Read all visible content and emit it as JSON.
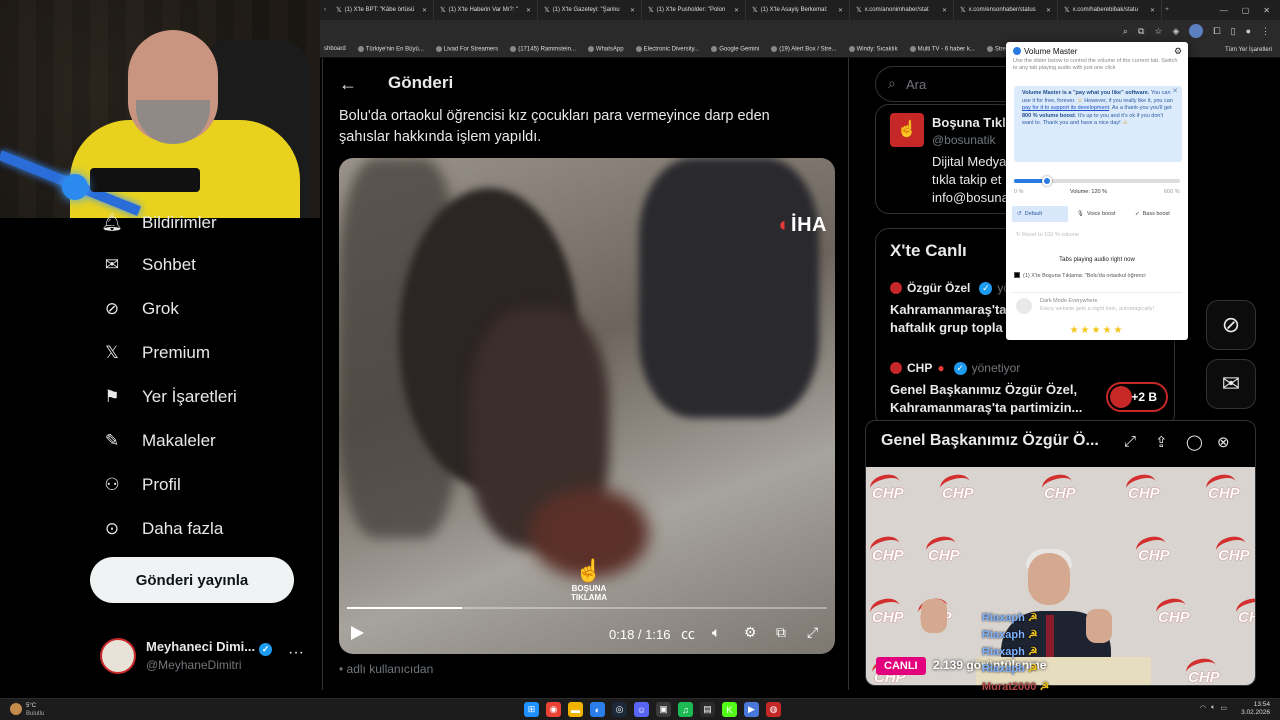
{
  "browser": {
    "tabs": [
      {
        "label": "(1) X'te BPT: \"Kâbe örtüsü"
      },
      {
        "label": "(1) X'te Haberin Var Mı?: \""
      },
      {
        "label": "(1) X'te Gazeteyi: \"Şanlıu"
      },
      {
        "label": "(1) X'te Pusholder: \"Polon"
      },
      {
        "label": "(1) X'te Asayiş Berkemal:"
      },
      {
        "label": "x.com/anonimhaber/stat"
      },
      {
        "label": "x.com/ensonhaber/status"
      },
      {
        "label": "x.com/haberebibak/statu"
      }
    ],
    "bookmarks": [
      "shboard",
      "Türkiye'nin En Büyü...",
      "Livad For Streamers",
      "(17145) Rammstein...",
      "WhatsApp",
      "Electronic Diversity...",
      "Google Gemini",
      "(19) Alert Box / Stre...",
      "Windy: Sıcaklık",
      "Multi TV - 6 haber k...",
      "Stream"
    ],
    "bookmarks_all": "Tüm Yer İşaretleri"
  },
  "sidebar": {
    "items": [
      {
        "label": "Bildirimler",
        "icon": "bell-icon"
      },
      {
        "label": "Sohbet",
        "icon": "mail-icon"
      },
      {
        "label": "Grok",
        "icon": "grok-icon"
      },
      {
        "label": "Premium",
        "icon": "x-logo-icon"
      },
      {
        "label": "Yer İşaretleri",
        "icon": "bookmark-icon"
      },
      {
        "label": "Makaleler",
        "icon": "article-icon"
      },
      {
        "label": "Profil",
        "icon": "person-icon"
      },
      {
        "label": "Daha fazla",
        "icon": "more-circle-icon"
      }
    ],
    "post_button": "Gönderi yayınla",
    "account": {
      "name": "Meyhaneci Dimi...",
      "handle": "@MeyhaneDimitri",
      "more": "···"
    }
  },
  "main": {
    "title": "Gönderi",
    "post_text": "Bolu'da ortaokul öğrencisi kız çocukları para vermeyince darp eden şahıslar hakkında işlem yapıldı.",
    "video": {
      "watermark": "İHA",
      "overlay_logo": "BOŞUNA TIKLAMA",
      "time": "0:18 / 1:16",
      "progress": 0.24
    },
    "below_text": "adlı kullanıcıdan"
  },
  "right": {
    "search_placeholder": "Ara",
    "promo": {
      "name": "Boşuna Tıkl",
      "handle": "@bosunatik",
      "desc_lines": [
        "Dijital Medya",
        "tıkla takip et",
        "info@bosuna"
      ]
    },
    "live": {
      "title": "X'te Canlı",
      "items": [
        {
          "name": "Özgür Özel",
          "role": "yön",
          "text_lines": [
            "Kahramanmaraş'ta",
            "haftalık grup topla"
          ]
        },
        {
          "name": "CHP",
          "role": "yönetiyor",
          "text_lines": [
            "Genel Başkanımız Özgür Özel,",
            "Kahramanmaraş'ta partimizin..."
          ]
        }
      ],
      "badge": "+2 B"
    }
  },
  "volume_master": {
    "title": "Volume Master",
    "hint": "Use the slider below to control the volume of the current tab. Switch to any tab playing audio with just one click",
    "note": {
      "bold": "Volume Master is a \"pay what you like\" software.",
      "p1": " You can use it for free, forever. ",
      "p2": "However, if you really like it, you can ",
      "link": "pay for it to support its development",
      "p3": ". As a thank-you you'll get ",
      "bold2": "800 % volume boost",
      "p4": ". It's up to you and it's ok if you don't want to. Thank you and have a nice day! "
    },
    "scale_min": "0 %",
    "volume_label": "Volume: 120 %",
    "scale_max": "600 %",
    "volume_fraction": 0.2,
    "presets": [
      "Default",
      "Voice boost",
      "Bass boost"
    ],
    "reset": "Reset to 100 % volume",
    "tabs_title": "Tabs playing audio right now",
    "playing_tab": "(1) X'te Boşuna Tıklama: \"Bolu'da ortaokul öğrenci",
    "ad_title": "Dark Mode Everywhere",
    "ad_desc": "Every website gets a night look, automagically!",
    "stars": "★★★★★"
  },
  "mini_player": {
    "title": "Genel Başkanımız Özgür Ö...",
    "live_badge": "CANLI",
    "viewers": "2.139 görüntülenme",
    "chp_word": "CHP",
    "chat": [
      {
        "name": "Riaxaph"
      },
      {
        "name": "Riaxaph"
      },
      {
        "name": "Riaxaph"
      },
      {
        "name": "Riaxaph"
      },
      {
        "name": "Murat2000"
      },
      {
        "name": "Riaxaph",
        "msg": "kâfi mi hocam"
      }
    ]
  },
  "taskbar": {
    "weather_temp": "5°C",
    "weather_desc": "Bulutlu",
    "time": "13:54",
    "date": "3.02.2026"
  }
}
